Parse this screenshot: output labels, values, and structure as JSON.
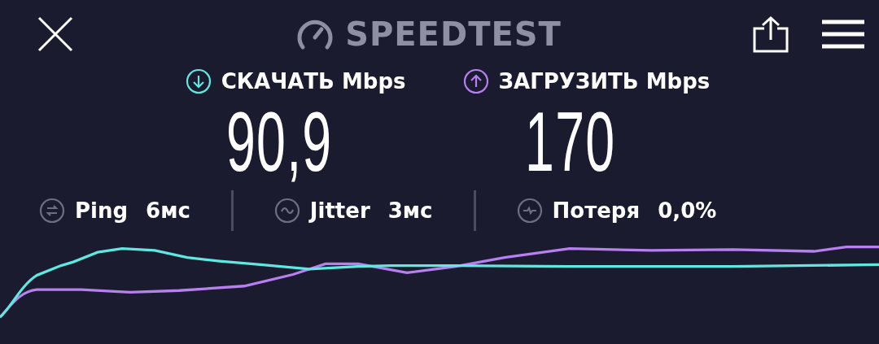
{
  "header": {
    "title": "SPEEDTEST"
  },
  "results": [
    {
      "kind": "download",
      "label": "СКАЧАТЬ Mbps",
      "value": "90,9",
      "color": "#5ee8e0"
    },
    {
      "kind": "upload",
      "label": "ЗАГРУЗИТЬ Mbps",
      "value": "170",
      "color": "#b77ff0"
    }
  ],
  "stats": [
    {
      "kind": "ping",
      "label": "Ping",
      "value": "6мс"
    },
    {
      "kind": "jitter",
      "label": "Jitter",
      "value": "3мс"
    },
    {
      "kind": "loss",
      "label": "Потеря",
      "value": "0,0%"
    }
  ]
}
